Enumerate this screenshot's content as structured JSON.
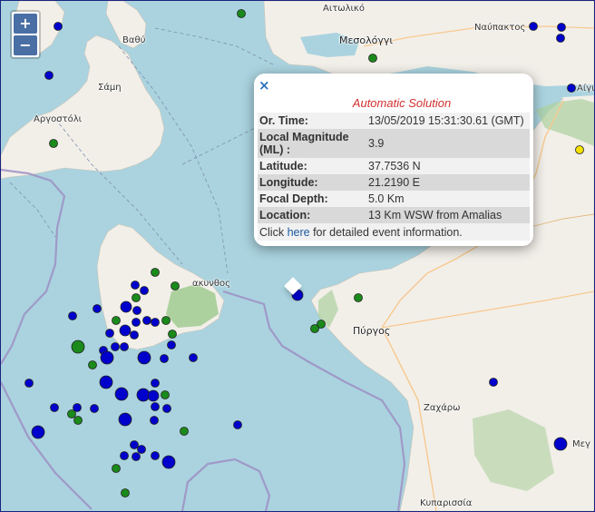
{
  "map": {
    "places": [
      {
        "id": "aitoliko",
        "label": "Αιτωλικό",
        "cls": "place"
      },
      {
        "id": "mesolongi",
        "label": "Μεσολόγγι",
        "cls": "place big"
      },
      {
        "id": "nafpaktos",
        "label": "Ναύπακτος",
        "cls": "place"
      },
      {
        "id": "vathy",
        "label": "Βαθύ",
        "cls": "place"
      },
      {
        "id": "sami",
        "label": "Σάμη",
        "cls": "place"
      },
      {
        "id": "argostoli",
        "label": "Αργοστόλι",
        "cls": "place"
      },
      {
        "id": "zakynthos",
        "label": "ακυνθος",
        "cls": "place"
      },
      {
        "id": "pyrgos",
        "label": "Πύργος",
        "cls": "place big"
      },
      {
        "id": "zacharo",
        "label": "Ζαχάρω",
        "cls": "place"
      },
      {
        "id": "kyparissia",
        "label": "Κυπαρισσία",
        "cls": "place"
      },
      {
        "id": "aigio",
        "label": "Αίγι",
        "cls": "place"
      },
      {
        "id": "meg",
        "label": "Μεγ",
        "cls": "place"
      }
    ],
    "colors": {
      "sea": "#aad3df",
      "land": "#f2efe9",
      "forest": "#add19e",
      "boundary": "#9e8fc4",
      "blue_event": "#0000cc",
      "green_event": "#1a8a1a",
      "yellow_event": "#f5e000"
    }
  },
  "zoom": {
    "in_label": "+",
    "out_label": "−"
  },
  "popup": {
    "close_label": "×",
    "title": "Automatic Solution",
    "rows": [
      {
        "key": "Or. Time:",
        "value": "13/05/2019 15:31:30.61 (GMT)"
      },
      {
        "key": "Local Magnitude (ML) :",
        "value": "3.9"
      },
      {
        "key": "Latitude:",
        "value": "37.7536 N"
      },
      {
        "key": "Longitude:",
        "value": "21.2190 E"
      },
      {
        "key": "Focal Depth:",
        "value": "5.0 Km"
      },
      {
        "key": "Location:",
        "value": "13 Km WSW from Amalias"
      }
    ],
    "click_prefix": "Click ",
    "click_link": "here",
    "click_suffix": " for detailed event information."
  }
}
